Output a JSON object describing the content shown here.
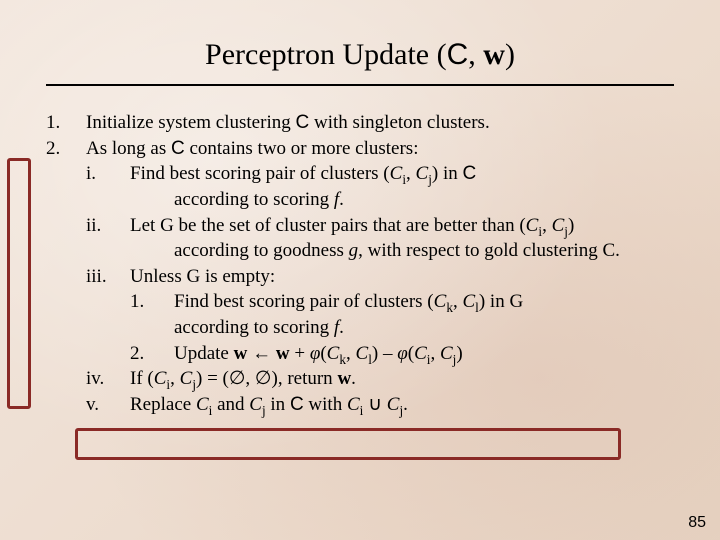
{
  "title": {
    "main": "Perceptron Update (",
    "C": "C",
    "sep": ", ",
    "w": "w",
    "close": ")"
  },
  "n1": "1.",
  "t1a": "Initialize system clustering ",
  "t1C": "C",
  "t1b": " with singleton clusters.",
  "n2": "2.",
  "t2a": "As long as ",
  "t2C": "C",
  "t2b": " contains two or more clusters:",
  "ni": "i.",
  "ti_a": "Find best scoring pair of clusters (",
  "ti_Ci": "C",
  "ti_i": "i",
  "ti_c1": ", ",
  "ti_Cj": "C",
  "ti_j": "j",
  "ti_b": ") in ",
  "ti_Cbold": "C",
  "ti_cont": "according to scoring ",
  "ti_f": "f",
  "ti_dot": ".",
  "nii": "ii.",
  "tii_a": "Let G be the set of cluster pairs that are better than (",
  "tii_Ci": "C",
  "tii_i": "i",
  "tii_c1": ", ",
  "tii_Cj": "C",
  "tii_j": "j",
  "tii_b": ")",
  "tii_cont1": "according to goodness ",
  "tii_g": "g",
  "tii_cont2": ", with respect to gold clustering C.",
  "niii": "iii.",
  "tiii": "Unless G is empty:",
  "niii1": "1.",
  "tiii1_a": "Find best scoring pair of clusters (",
  "tiii1_Ck": "C",
  "tiii1_k": "k",
  "tiii1_c1": ", ",
  "tiii1_Cl": "C",
  "tiii1_l": "l",
  "tiii1_b": ") in G",
  "tiii1_cont": "according to scoring ",
  "tiii1_f": "f",
  "tiii1_dot": ".",
  "niii2": "2.",
  "tiii2_a": "Update ",
  "tiii2_w1": "w",
  "tiii2_arrow": " ← ",
  "tiii2_w2": "w",
  "tiii2_plus": " + ",
  "tiii2_phi1": "φ",
  "tiii2_p1": "(",
  "tiii2_Ck": "C",
  "tiii2_k": "k",
  "tiii2_c1": ", ",
  "tiii2_Cl": "C",
  "tiii2_l": "l",
  "tiii2_p2": ") – ",
  "tiii2_phi2": "φ",
  "tiii2_p3": "(",
  "tiii2_Ci": "C",
  "tiii2_i": "i",
  "tiii2_c2": ", ",
  "tiii2_Cj": "C",
  "tiii2_j": "j",
  "tiii2_p4": ")",
  "niv": "iv.",
  "tiv_a": "If  (",
  "tiv_Ci": "C",
  "tiv_i": "i",
  "tiv_c1": ", ",
  "tiv_Cj": "C",
  "tiv_j": "j",
  "tiv_b": ") = (∅, ∅), return ",
  "tiv_w": "w",
  "tiv_dot": ".",
  "nv": "v.",
  "tv_a": "Replace ",
  "tv_Ci": "C",
  "tv_i": "i",
  "tv_and": " and ",
  "tv_Cj": "C",
  "tv_j": "j",
  "tv_in": " in ",
  "tv_Cbold": "C",
  "tv_with": " with ",
  "tv_Ci2": "C",
  "tv_i2": "i",
  "tv_cup": " ∪ ",
  "tv_Cj2": "C",
  "tv_j2": "j",
  "tv_dot": ".",
  "pagenum": "85"
}
